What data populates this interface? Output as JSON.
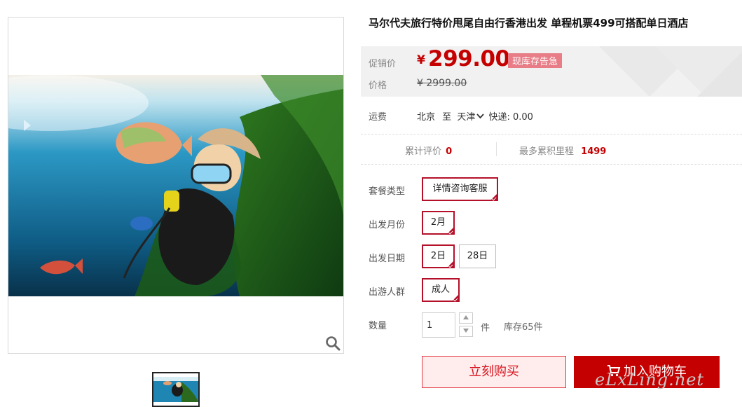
{
  "product": {
    "title": "马尔代夫旅行特价甩尾自由行香港出发 单程机票499可搭配单日酒店"
  },
  "price": {
    "promo_label": "促销价",
    "currency": "¥",
    "promo_value": "299.00",
    "stock_badge": "现库存告急",
    "orig_label": "价格",
    "orig_value": "¥ 2999.00"
  },
  "shipping": {
    "label": "运费",
    "from": "北京",
    "to_word": "至",
    "to": "天津",
    "method": "快递: 0.00"
  },
  "stats": {
    "reviews_label": "累计评价",
    "reviews_value": "0",
    "miles_label": "最多累积里程",
    "miles_value": "1499"
  },
  "options": {
    "package_label": "套餐类型",
    "package_values": [
      "详情咨询客服"
    ],
    "month_label": "出发月份",
    "month_values": [
      "2月"
    ],
    "date_label": "出发日期",
    "date_values": [
      "2日",
      "28日"
    ],
    "people_label": "出游人群",
    "people_values": [
      "成人"
    ]
  },
  "quantity": {
    "label": "数量",
    "value": "1",
    "unit": "件",
    "stock": "库存65件"
  },
  "actions": {
    "buy_now": "立刻购买",
    "add_cart": "加入购物车"
  },
  "watermark": "eLxLing.net",
  "icons": {
    "zoom": "magnifier-icon",
    "dropdown": "chevron-down-icon",
    "cart": "cart-icon",
    "selected": "check-corner-icon",
    "stepper_up": "triangle-up-icon",
    "stepper_down": "triangle-down-icon"
  },
  "colors": {
    "accent_red": "#c40000",
    "select_border": "#b5102a",
    "badge_pink": "#e87c87",
    "buy_now_bg": "#ffeded"
  }
}
